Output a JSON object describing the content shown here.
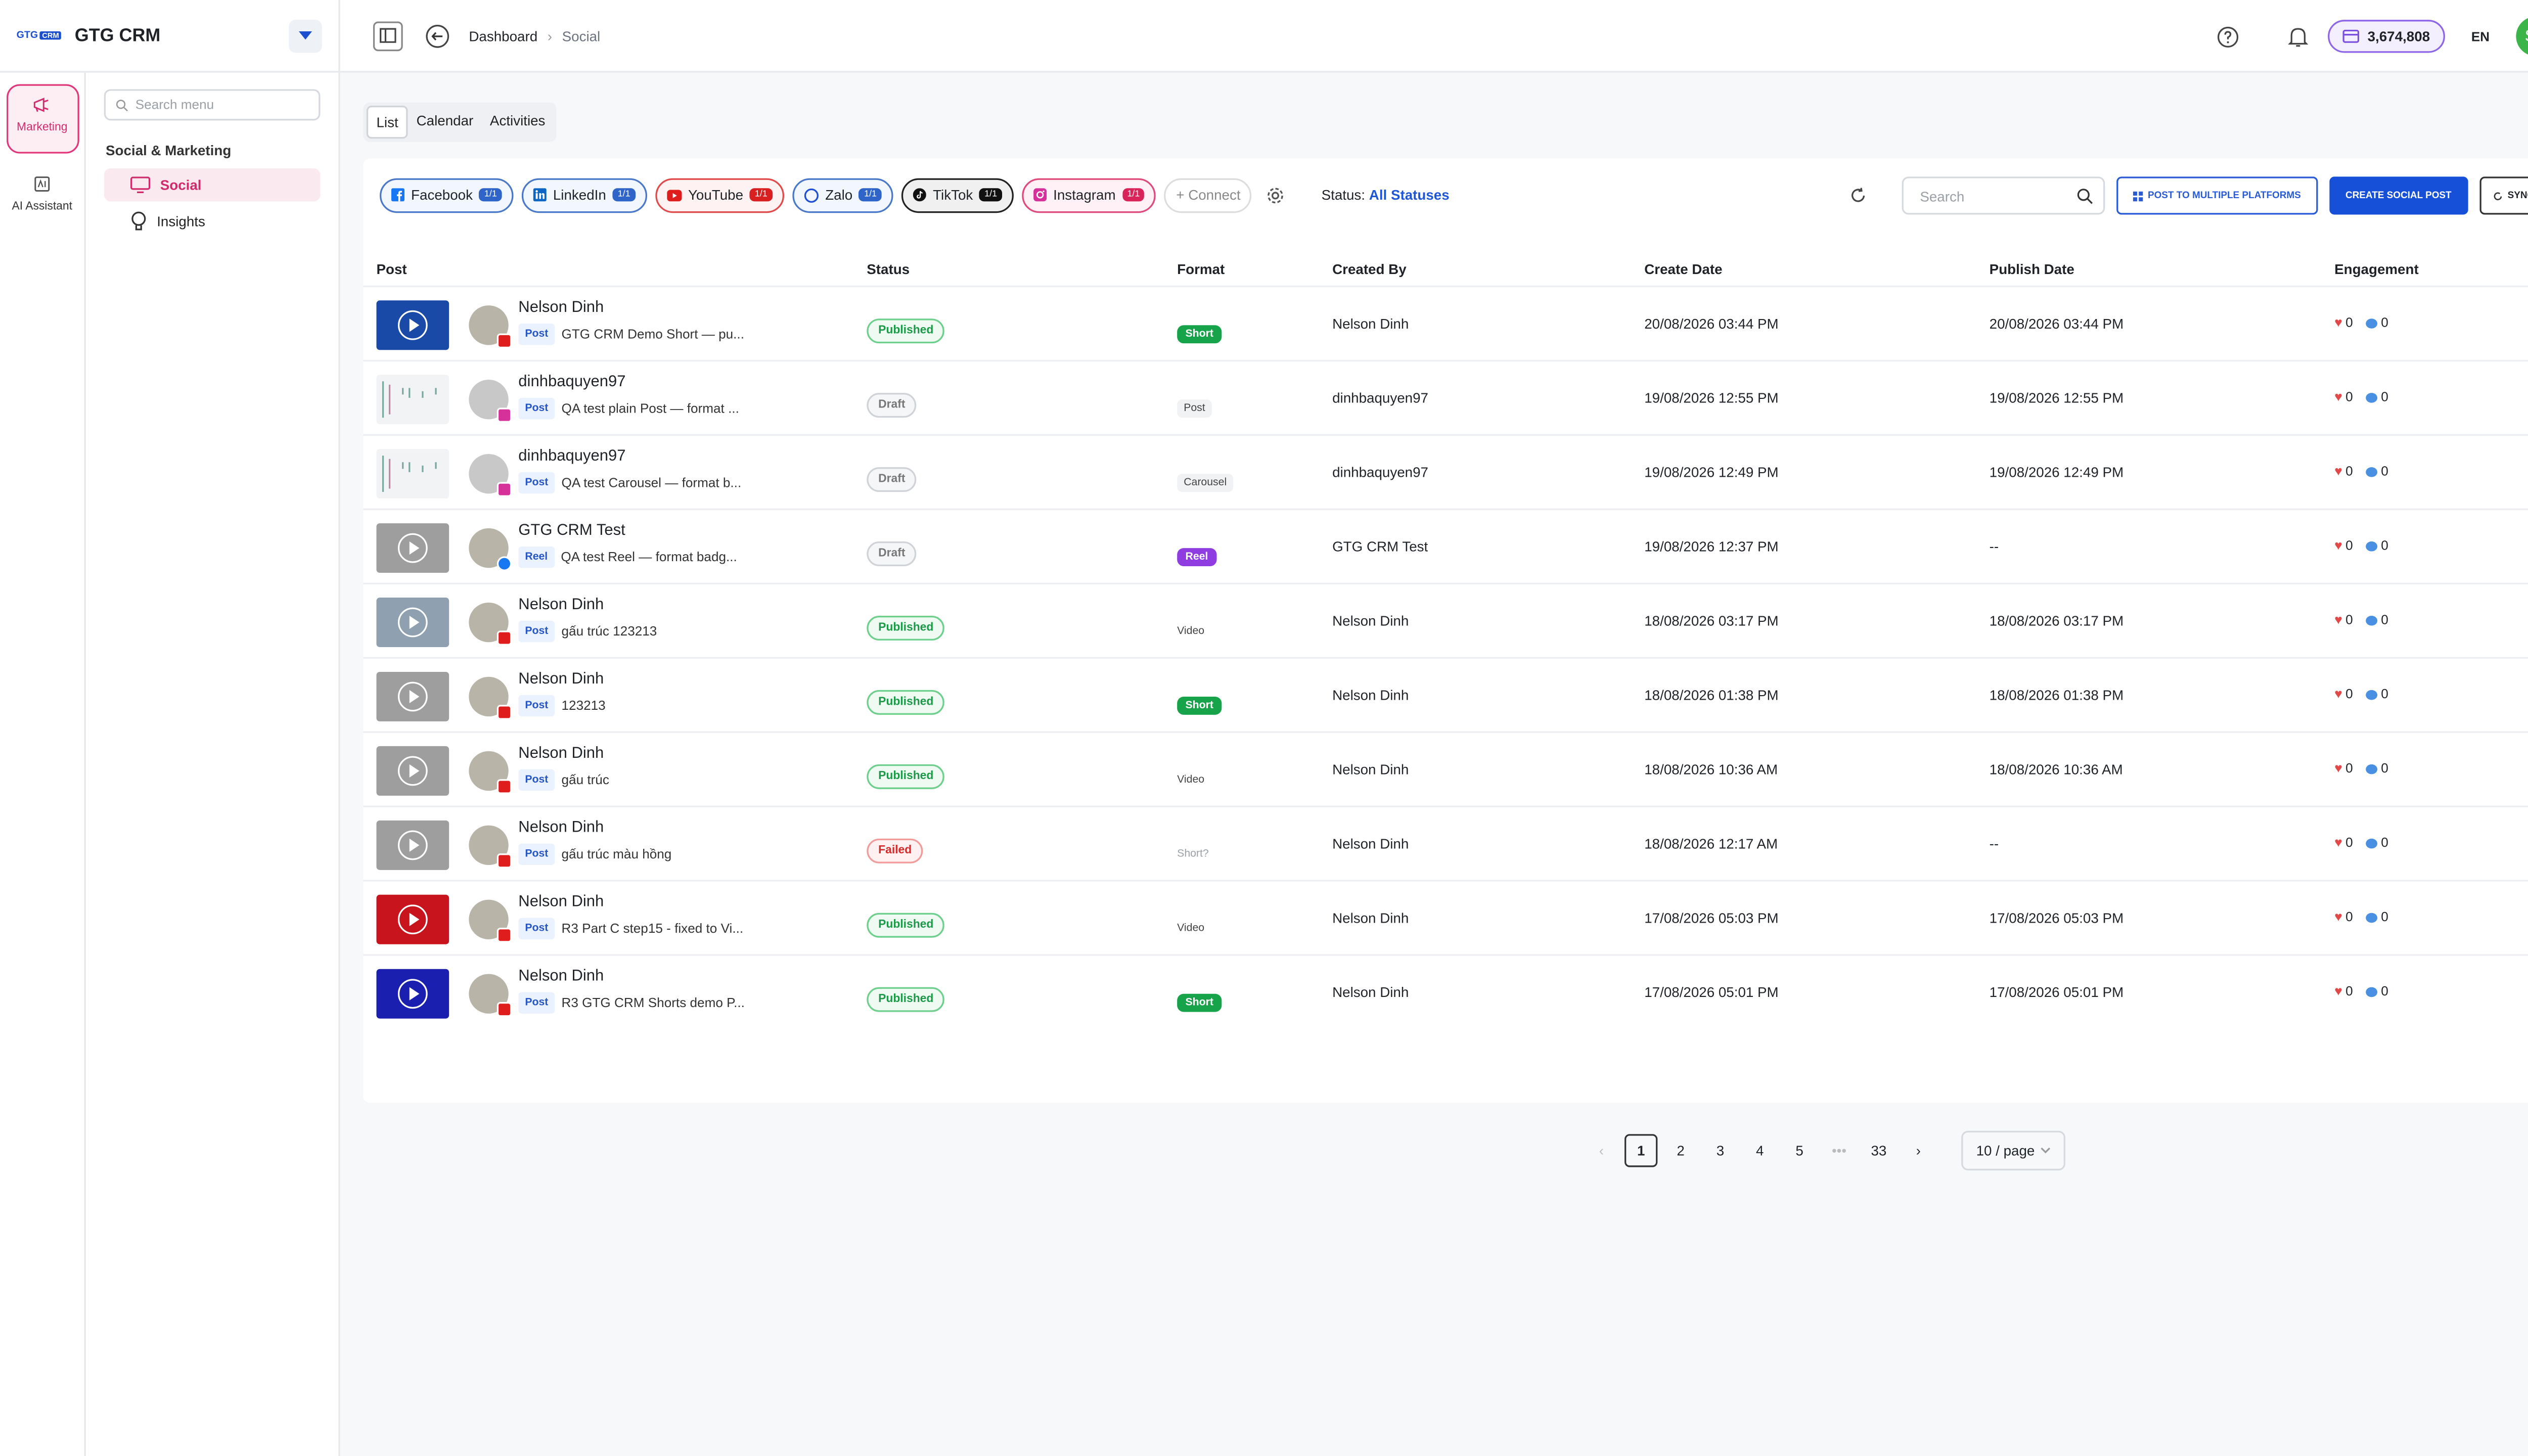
{
  "app": {
    "logo_text": "GTG",
    "logo_badge": "CRM",
    "title": "GTG CRM"
  },
  "rail": [
    {
      "label": "Marketing",
      "icon": "megaphone-icon",
      "active": true
    },
    {
      "label": "AI Assistant",
      "icon": "ai-icon",
      "active": false
    }
  ],
  "menu": {
    "search_placeholder": "Search menu",
    "group": "Social & Marketing",
    "items": [
      {
        "label": "Social",
        "icon": "monitor-icon",
        "active": true
      },
      {
        "label": "Insights",
        "icon": "bulb-icon",
        "active": false
      }
    ]
  },
  "header": {
    "breadcrumb": [
      "Dashboard",
      "Social"
    ],
    "credits": "3,674,808",
    "lang": "EN",
    "avatar": "SP"
  },
  "tabs": [
    "List",
    "Calendar",
    "Activities"
  ],
  "toolbar": {
    "platforms": [
      {
        "key": "fb",
        "label": "Facebook",
        "count": "1/1"
      },
      {
        "key": "li",
        "label": "LinkedIn",
        "count": "1/1"
      },
      {
        "key": "yt",
        "label": "YouTube",
        "count": "1/1"
      },
      {
        "key": "za",
        "label": "Zalo",
        "count": "1/1"
      },
      {
        "key": "tt",
        "label": "TikTok",
        "count": "1/1"
      },
      {
        "key": "ig",
        "label": "Instagram",
        "count": "1/1"
      }
    ],
    "connect_label": "+ Connect",
    "status_label": "Status:",
    "status_value": "All Statuses",
    "search_placeholder": "Search",
    "post_multi_label": "POST TO MULTIPLE PLATFORMS",
    "create_label": "CREATE SOCIAL POST",
    "sync_label": "SYNC"
  },
  "columns": [
    "Post",
    "Status",
    "Format",
    "Created By",
    "Create Date",
    "Publish Date",
    "Engagement"
  ],
  "rows": [
    {
      "thumb": "blue",
      "avatar": "photo",
      "net": "yt",
      "name": "Nelson Dinh",
      "type": "Post",
      "text": "GTG CRM Demo Short — pu...",
      "status": "Published",
      "format": "Short",
      "created_by": "Nelson Dinh",
      "create_date": "20/08/2026 03:44 PM",
      "publish_date": "20/08/2026 03:44 PM",
      "likes": "0",
      "comments": "0"
    },
    {
      "thumb": "sketch",
      "avatar": "gray",
      "net": "ig",
      "name": "dinhbaquyen97",
      "type": "Post",
      "text": "QA test plain Post — format ...",
      "status": "Draft",
      "format": "Post",
      "created_by": "dinhbaquyen97",
      "create_date": "19/08/2026 12:55 PM",
      "publish_date": "19/08/2026 12:55 PM",
      "likes": "0",
      "comments": "0"
    },
    {
      "thumb": "sketch",
      "avatar": "gray",
      "net": "ig",
      "name": "dinhbaquyen97",
      "type": "Post",
      "text": "QA test Carousel — format b...",
      "status": "Draft",
      "format": "Carousel",
      "created_by": "dinhbaquyen97",
      "create_date": "19/08/2026 12:49 PM",
      "publish_date": "19/08/2026 12:49 PM",
      "likes": "0",
      "comments": "0"
    },
    {
      "thumb": "gray",
      "avatar": "photo",
      "net": "fb",
      "name": "GTG CRM Test",
      "type": "Reel",
      "text": "QA test Reel — format badg...",
      "status": "Draft",
      "format": "Reel",
      "created_by": "GTG CRM Test",
      "create_date": "19/08/2026 12:37 PM",
      "publish_date": "--",
      "likes": "0",
      "comments": "0"
    },
    {
      "thumb": "shot",
      "avatar": "photo",
      "net": "yt",
      "name": "Nelson Dinh",
      "type": "Post",
      "text": "gấu trúc 123213",
      "status": "Published",
      "format": "Video",
      "created_by": "Nelson Dinh",
      "create_date": "18/08/2026 03:17 PM",
      "publish_date": "18/08/2026 03:17 PM",
      "likes": "0",
      "comments": "0"
    },
    {
      "thumb": "gray",
      "avatar": "photo",
      "net": "yt",
      "name": "Nelson Dinh",
      "type": "Post",
      "text": "123213",
      "status": "Published",
      "format": "Short",
      "created_by": "Nelson Dinh",
      "create_date": "18/08/2026 01:38 PM",
      "publish_date": "18/08/2026 01:38 PM",
      "likes": "0",
      "comments": "0"
    },
    {
      "thumb": "gray",
      "avatar": "photo",
      "net": "yt",
      "name": "Nelson Dinh",
      "type": "Post",
      "text": "gấu trúc",
      "status": "Published",
      "format": "Video",
      "created_by": "Nelson Dinh",
      "create_date": "18/08/2026 10:36 AM",
      "publish_date": "18/08/2026 10:36 AM",
      "likes": "0",
      "comments": "0"
    },
    {
      "thumb": "gray",
      "avatar": "photo",
      "net": "yt",
      "name": "Nelson Dinh",
      "type": "Post",
      "text": "gấu trúc màu hồng",
      "status": "Failed",
      "format": "Short?",
      "created_by": "Nelson Dinh",
      "create_date": "18/08/2026 12:17 AM",
      "publish_date": "--",
      "likes": "0",
      "comments": "0"
    },
    {
      "thumb": "red",
      "avatar": "photo",
      "net": "yt",
      "name": "Nelson Dinh",
      "type": "Post",
      "text": "R3 Part C step15 - fixed to Vi...",
      "status": "Published",
      "format": "Video",
      "created_by": "Nelson Dinh",
      "create_date": "17/08/2026 05:03 PM",
      "publish_date": "17/08/2026 05:03 PM",
      "likes": "0",
      "comments": "0"
    },
    {
      "thumb": "blue2",
      "avatar": "photo",
      "net": "yt",
      "name": "Nelson Dinh",
      "type": "Post",
      "text": "R3 GTG CRM Shorts demo P...",
      "status": "Published",
      "format": "Short",
      "created_by": "Nelson Dinh",
      "create_date": "17/08/2026 05:01 PM",
      "publish_date": "17/08/2026 05:01 PM",
      "likes": "0",
      "comments": "0"
    }
  ],
  "pagination": {
    "prev": "‹",
    "pages": [
      "1",
      "2",
      "3",
      "4",
      "5"
    ],
    "ellipsis": "•••",
    "last": "33",
    "next": "›",
    "current": "1",
    "page_size": "10 / page"
  }
}
